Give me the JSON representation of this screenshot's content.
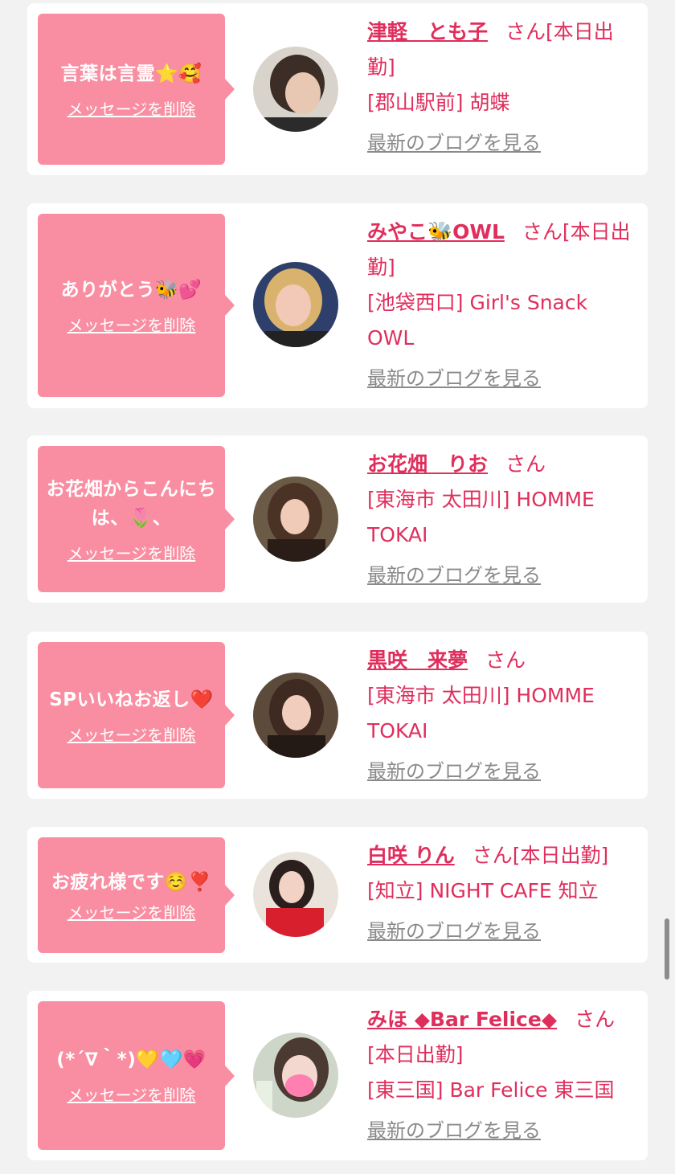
{
  "common": {
    "delete_label": "メッセージを削除",
    "blog_label": "最新のブログを見る",
    "san": "さん"
  },
  "messages": [
    {
      "text": "言葉は言霊⭐🥰",
      "name": "津軽　とも子",
      "work_line": "[本日出勤]",
      "shop": "[郡山駅前] 胡蝶",
      "avatar_icon": "girl-profile-photo"
    },
    {
      "text": "ありがとう🐝💕",
      "name": "みやこ🐝OWL",
      "work_line": "[本日出勤]",
      "shop": "[池袋西口] Girl's Snack OWL",
      "avatar_icon": "girl-profile-photo"
    },
    {
      "text": "お花畑からこんにちは、🌷、",
      "name": "お花畑　りお",
      "work_line": "",
      "shop": "[東海市 太田川] HOMME TOKAI",
      "avatar_icon": "girl-profile-photo"
    },
    {
      "text": "SPいいねお返し❤️",
      "name": "黒咲　来夢",
      "work_line": "",
      "shop": "[東海市 太田川] HOMME TOKAI",
      "avatar_icon": "girl-profile-photo"
    },
    {
      "text": "お疲れ様です☺️❣️",
      "name": "白咲 りん",
      "work_line": "[本日出勤]",
      "shop": "[知立] NIGHT CAFE 知立",
      "avatar_icon": "girl-profile-photo"
    },
    {
      "text": "(*´∇｀*)💛🩵💗",
      "name": "みほ ◆Bar Felice◆",
      "work_line": "[本日出勤]",
      "shop": "[東三国] Bar Felice 東三国",
      "avatar_icon": "girl-profile-photo"
    }
  ],
  "colors": {
    "accent": "#e02e5c",
    "bubble": "#f98ea2",
    "background": "#f2f2f3",
    "link_gray": "#8a8a8a"
  }
}
